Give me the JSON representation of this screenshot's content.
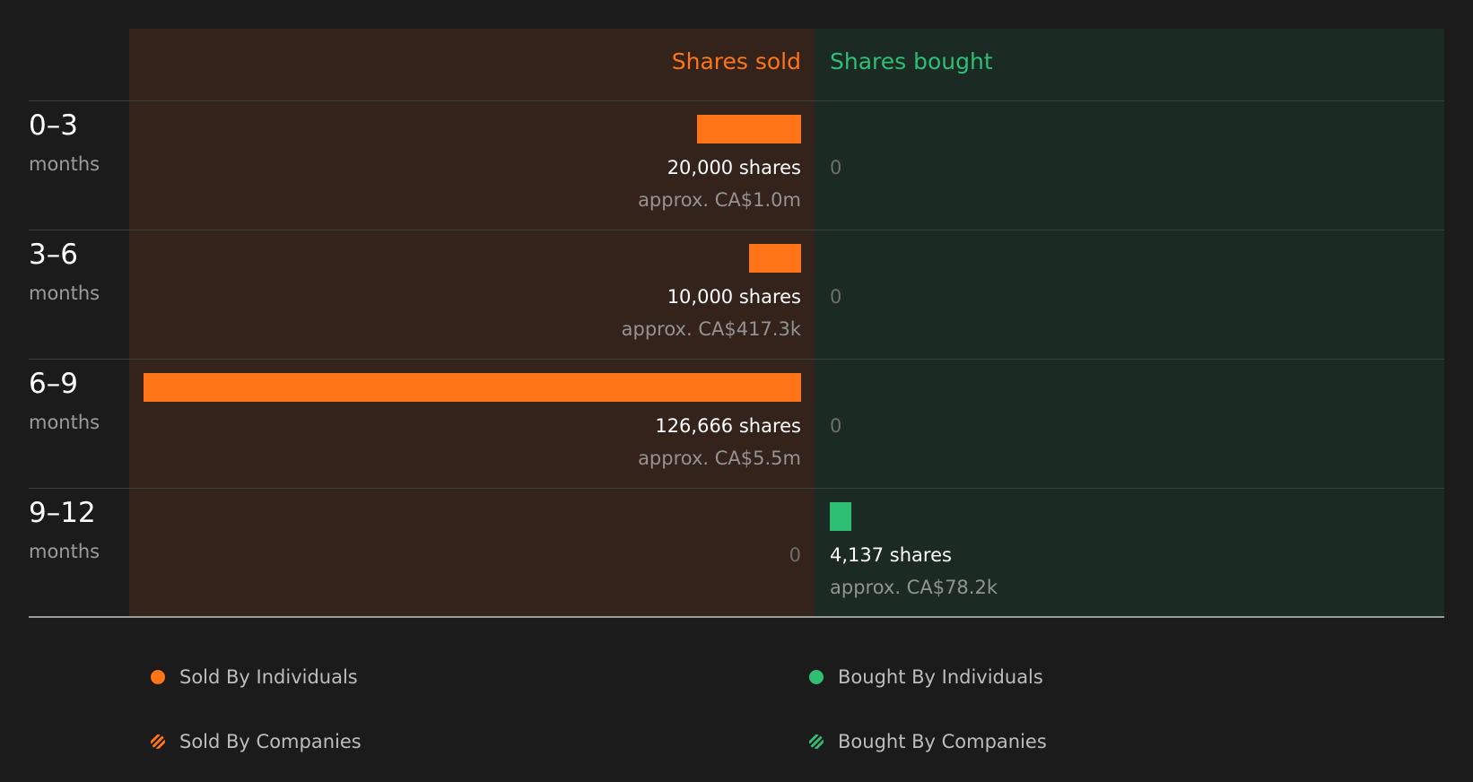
{
  "chart_data": {
    "type": "bar",
    "headers": {
      "sold": "Shares sold",
      "bought": "Shares bought"
    },
    "categories": [
      {
        "range": "0–3",
        "unit": "months"
      },
      {
        "range": "3–6",
        "unit": "months"
      },
      {
        "range": "6–9",
        "unit": "months"
      },
      {
        "range": "9–12",
        "unit": "months"
      }
    ],
    "series": [
      {
        "name": "Shares sold",
        "values": [
          20000,
          10000,
          126666,
          0
        ],
        "labels": [
          "20,000 shares",
          "10,000 shares",
          "126,666 shares",
          "0"
        ],
        "values_text": [
          "approx. CA$1.0m",
          "approx. CA$417.3k",
          "approx. CA$5.5m",
          ""
        ]
      },
      {
        "name": "Shares bought",
        "values": [
          0,
          0,
          0,
          4137
        ],
        "labels": [
          "0",
          "0",
          "0",
          "4,137 shares"
        ],
        "values_text": [
          "",
          "",
          "",
          "approx. CA$78.2k"
        ]
      }
    ],
    "xlim": [
      0,
      126666
    ],
    "legend": [
      {
        "label": "Sold By Individuals",
        "marker": "dot",
        "color": "#ff7417"
      },
      {
        "label": "Sold By Companies",
        "marker": "hatched",
        "color": "#ff7417"
      },
      {
        "label": "Bought By Individuals",
        "marker": "dot",
        "color": "#2ebf74"
      },
      {
        "label": "Bought By Companies",
        "marker": "hatched",
        "color": "#2ebf74"
      }
    ],
    "legend_position": "bottom",
    "colors": {
      "sold": "#ff7417",
      "bought": "#2ebf74",
      "sold_panel": "#33231b",
      "bought_panel": "#1b2b24"
    }
  }
}
